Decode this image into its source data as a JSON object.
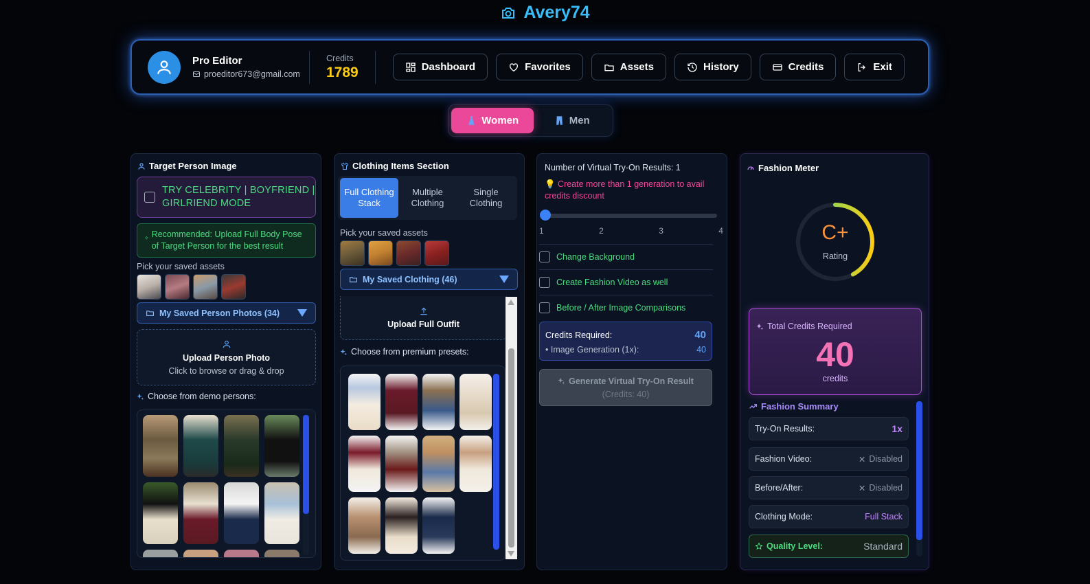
{
  "app": {
    "title": "Avery74"
  },
  "user": {
    "name": "Pro Editor",
    "email": "proeditor673@gmail.com"
  },
  "credits": {
    "label": "Credits",
    "value": "1789"
  },
  "nav": [
    "Dashboard",
    "Favorites",
    "Assets",
    "History",
    "Credits",
    "Exit"
  ],
  "gender": {
    "women": "Women",
    "men": "Men",
    "selected": "Women"
  },
  "target": {
    "title": "Target Person Image",
    "celeb_mode": "TRY CELEBRITY | BOYFRIEND | GIRLRIEND MODE",
    "recommend": "Recommended: Upload Full Body Pose of Target Person for the best result",
    "pick_label": "Pick your saved assets",
    "dropdown": "My Saved Person Photos (34)",
    "upload_title": "Upload Person Photo",
    "upload_sub": "Click to browse or drag & drop",
    "demo_label": "Choose from demo persons:"
  },
  "clothing": {
    "title": "Clothing Items Section",
    "modes": [
      "Full Clothing Stack",
      "Multiple Clothing",
      "Single Clothing"
    ],
    "active_mode": "Full Clothing Stack",
    "pick_label": "Pick your saved assets",
    "dropdown": "My Saved Clothing (46)",
    "upload_title": "Upload Full Outfit",
    "presets_label": "Choose from premium presets:"
  },
  "config": {
    "results_label": "Number of Virtual Try-On Results: 1",
    "tip": "💡 Create more than 1 generation to avail credits discount",
    "slider": {
      "min": 1,
      "max": 4,
      "value": 1,
      "ticks": [
        "1",
        "2",
        "3",
        "4"
      ]
    },
    "options": [
      "Change Background",
      "Create Fashion Video as well",
      "Before / After Image Comparisons"
    ],
    "credits_required_label": "Credits Required:",
    "credits_required_value": "40",
    "image_gen_label": "• Image Generation (1x):",
    "image_gen_value": "40",
    "generate_label": "Generate Virtual Try-On Result",
    "generate_sub": "(Credits: 40)"
  },
  "meter": {
    "title": "Fashion Meter",
    "grade": "C+",
    "rating_label": "Rating",
    "rating_fraction": 0.42,
    "total_label": "Total Credits Required",
    "total_value": "40",
    "total_unit": "credits",
    "summary_title": "Fashion Summary",
    "summary": [
      {
        "key": "Try-On Results:",
        "value": "1x"
      },
      {
        "key": "Fashion Video:",
        "value": "Disabled"
      },
      {
        "key": "Before/After:",
        "value": "Disabled"
      },
      {
        "key": "Clothing Mode:",
        "value": "Full Stack"
      },
      {
        "key": "Quality Level:",
        "value": "Standard"
      }
    ]
  },
  "colors": {
    "accent_blue": "#3b82f6",
    "pink": "#ec4899",
    "green": "#4ade80",
    "gold": "#facc15"
  }
}
